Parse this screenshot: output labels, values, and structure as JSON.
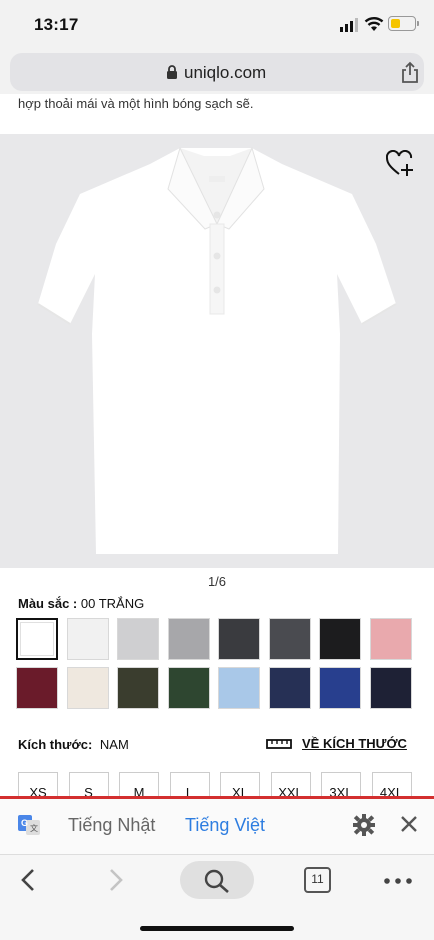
{
  "status": {
    "time": "13:17"
  },
  "browser": {
    "url": "uniqlo.com"
  },
  "product": {
    "description_tail": "hợp thoải mái và một hình bóng sạch sẽ.",
    "image_counter": "1/6",
    "color_label": "Màu sắc :",
    "color_value": "00 TRẮNG",
    "swatches": [
      {
        "color": "#ffffff",
        "selected": true
      },
      {
        "color": "#f1f1f1"
      },
      {
        "color": "#cfcfd1"
      },
      {
        "color": "#a7a7aa"
      },
      {
        "color": "#3a3b3f"
      },
      {
        "color": "#4a4b50"
      },
      {
        "color": "#1c1c1e"
      },
      {
        "color": "#e9a9ad"
      },
      {
        "color": "#6a1b2a"
      },
      {
        "color": "#efe8df"
      },
      {
        "color": "#3a3d2e"
      },
      {
        "color": "#2e4630"
      },
      {
        "color": "#a9c8e8"
      },
      {
        "color": "#263055"
      },
      {
        "color": "#283f8e"
      },
      {
        "color": "#1e2135"
      }
    ],
    "size_label": "Kích thước:",
    "size_value": "NAM",
    "size_guide": "VỀ KÍCH THƯỚC",
    "sizes": [
      "XS",
      "S",
      "M",
      "L",
      "XL",
      "XXL",
      "3XL",
      "4XL"
    ]
  },
  "translate": {
    "source_lang": "Tiếng Nhật",
    "target_lang": "Tiếng Việt",
    "accent_color": "#2d7de0",
    "bar_color": "#d32f2f"
  },
  "toolbar": {
    "tab_count": "11"
  }
}
